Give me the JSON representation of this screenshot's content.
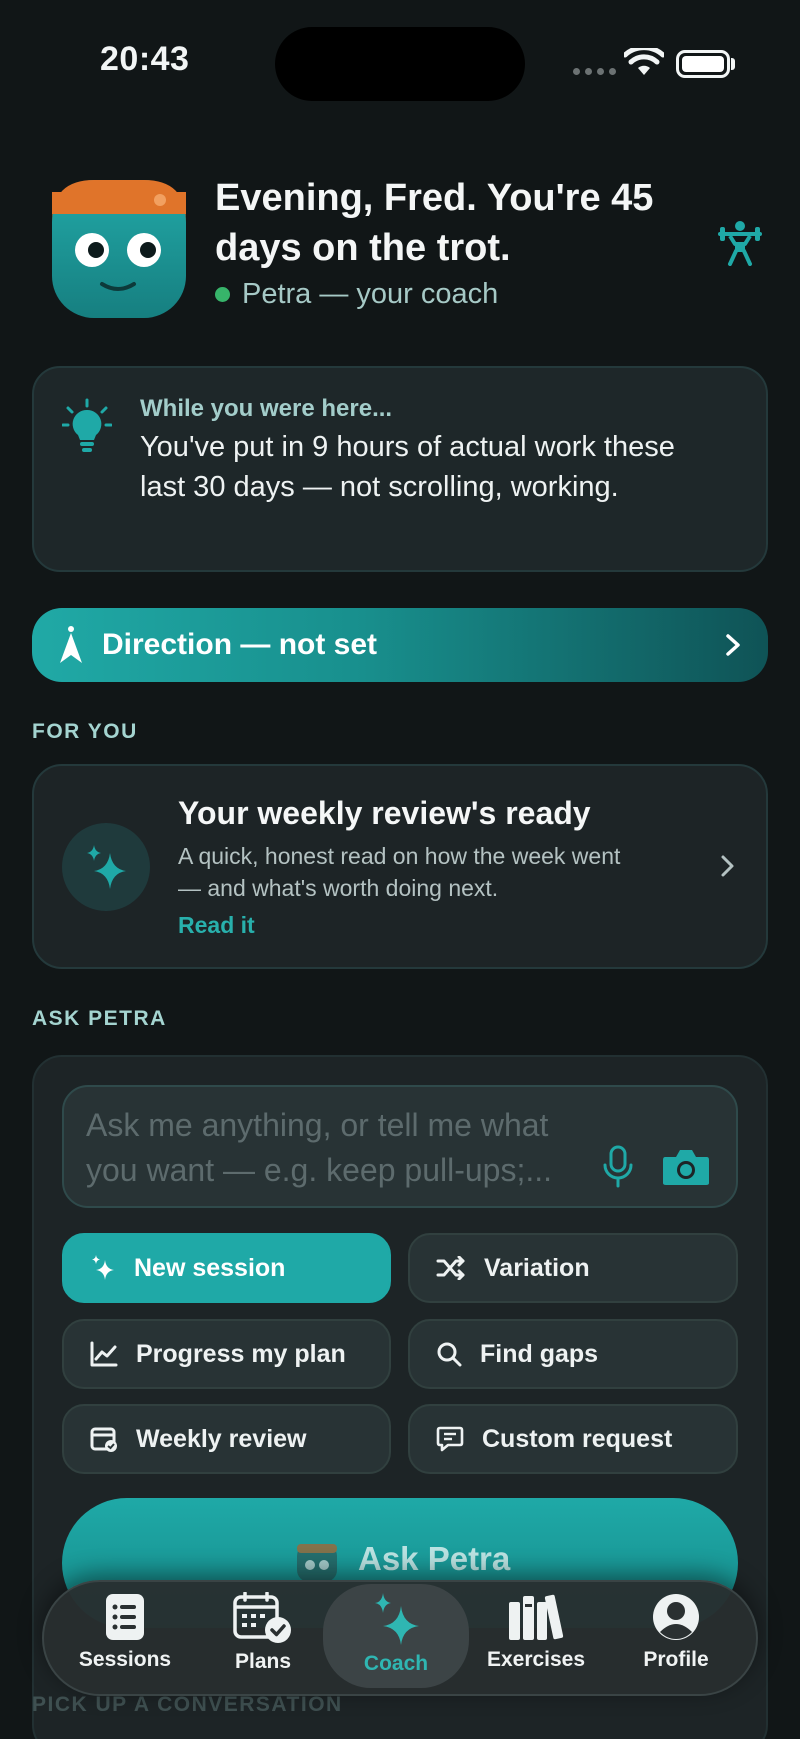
{
  "status_bar": {
    "time": "20:43"
  },
  "header": {
    "greeting": "Evening, Fred. You're 45 days on the trot.",
    "coach_line": "Petra — your coach"
  },
  "insight": {
    "kicker": "While you were here...",
    "text": "You've put in 9 hours of actual work these last 30 days — not scrolling, working."
  },
  "direction": {
    "label": "Direction — not set"
  },
  "for_you": {
    "section_label": "FOR YOU",
    "card": {
      "title": "Your weekly review's ready",
      "description": "A quick, honest read on how the week went — and what's worth doing next.",
      "link": "Read it"
    }
  },
  "ask": {
    "section_label": "ASK PETRA",
    "placeholder": "Ask me anything, or tell me what you want — e.g. keep pull-ups;...",
    "chips": [
      {
        "label": "New session",
        "icon": "sparkle-icon"
      },
      {
        "label": "Variation",
        "icon": "shuffle-icon"
      },
      {
        "label": "Progress my plan",
        "icon": "chart-icon"
      },
      {
        "label": "Find gaps",
        "icon": "search-icon"
      },
      {
        "label": "Weekly review",
        "icon": "calendar-icon"
      },
      {
        "label": "Custom request",
        "icon": "message-icon"
      }
    ],
    "button_label": "Ask Petra"
  },
  "conversation_section_label": "PICK UP A CONVERSATION",
  "tabs": [
    {
      "label": "Sessions",
      "icon": "sessions-icon"
    },
    {
      "label": "Plans",
      "icon": "plans-icon"
    },
    {
      "label": "Coach",
      "icon": "coach-sparkle-icon",
      "active": true
    },
    {
      "label": "Exercises",
      "icon": "books-icon"
    },
    {
      "label": "Profile",
      "icon": "profile-icon"
    }
  ],
  "colors": {
    "accent": "#1FA9A7",
    "background": "#111617",
    "card": "#1D2426",
    "online": "#37B46A"
  }
}
